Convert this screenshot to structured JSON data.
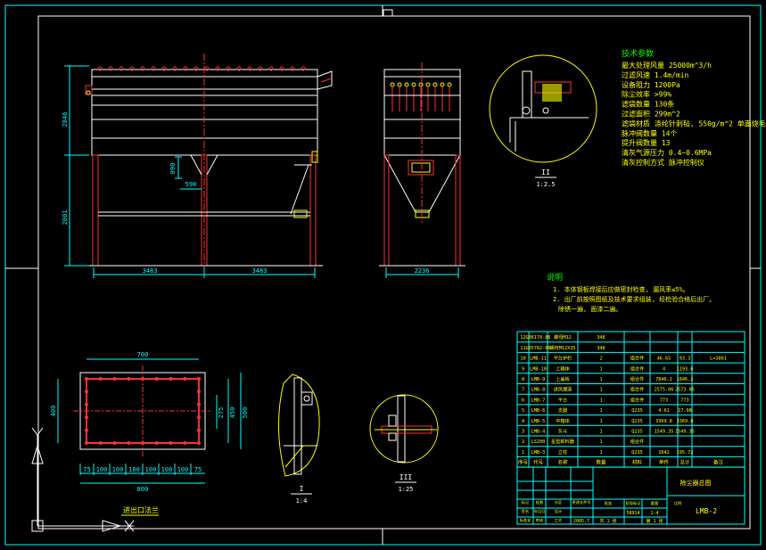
{
  "title_block": {
    "drawing_name": "除尘器总图",
    "drawing_no": "LMB-2",
    "labels": [
      "标记",
      "处数",
      "分区",
      "更改文件号",
      "签名",
      "年月日",
      "设计",
      "标准化",
      "审核",
      "工艺",
      "批准",
      "阶段标记",
      "重量",
      "比例"
    ],
    "weight": "58914",
    "scale": "1:4",
    "sheet": "共 1 张",
    "sheet_no": "第 1 张",
    "date": "2005.7"
  },
  "tech_params": {
    "heading": "技术参数",
    "lines": [
      "最大处理风量 25000m^3/h",
      "过滤风速 1.4m/min",
      "设备阻力 1200Pa",
      "除尘效率 >99%",
      "滤袋数量 130条",
      "过滤面积 299m^2",
      "滤袋材质 涤纶针刺毡, 550g/m^2 单面烧毛",
      "脉冲阀数量 14个",
      "提升阀数量 13",
      "清灰气源压力 0.4~0.6MPa",
      "清灰控制方式 脉冲控制仪"
    ]
  },
  "notes": {
    "heading": "说明",
    "lines": [
      "1. 本体钢板焊接后应做密封检查, 漏风率≤5%。",
      "2. 出厂前按照图纸及技术要求组装, 经检验合格后出厂。",
      "除锈一遍, 面漆二遍。"
    ]
  },
  "views": {
    "detail_2": {
      "label": "II",
      "scale": "1:2.5"
    },
    "detail_1": {
      "label": "I",
      "scale": "1:4"
    },
    "detail_3": {
      "label": "III",
      "scale": "1:25"
    },
    "flange_caption": "进出口法兰"
  },
  "dimensions": {
    "front_height_top": "2846",
    "front_height_bottom": "2001",
    "front_width_left": "3483",
    "front_width_right": "3483",
    "side_width": "2236",
    "hopper_outlet_h": "890",
    "hopper_outlet_w": "590",
    "flange_width": "700",
    "flange_overall": "800",
    "flange_height_left": "400",
    "flange_inner_h": "275",
    "flange_mid_h": "450",
    "flange_outer_h": "500",
    "flange_pitches": [
      "75",
      "100",
      "100",
      "100",
      "100",
      "100",
      "100",
      "75"
    ]
  },
  "bom": {
    "headers": [
      "序号",
      "代号",
      "名称",
      "数量",
      "材料",
      "单件",
      "总计",
      "备注"
    ],
    "rows": [
      [
        "12",
        "GB6170-86",
        "螺母M12",
        "348",
        "",
        "",
        "",
        ""
      ],
      [
        "11",
        "GB5782-86",
        "螺栓M12X35",
        "348",
        "",
        "",
        "",
        ""
      ],
      [
        "10",
        "LMB-11",
        "平台护栏",
        "2",
        "组合件",
        "46.65",
        "93.3",
        "L=3861"
      ],
      [
        "9",
        "LMB-10",
        "上箱体",
        "1",
        "组合件",
        "4",
        "1193.6",
        ""
      ],
      [
        "8",
        "LMB-9",
        "上盖板",
        "1",
        "组合件",
        "7846.2",
        "1846.2",
        ""
      ],
      [
        "7",
        "LMB-8",
        "进风烟道",
        "1",
        "组合件",
        "2575.06",
        "2573.05",
        ""
      ],
      [
        "6",
        "LMB-7",
        "平台",
        "1",
        "组合件",
        "773",
        "773",
        ""
      ],
      [
        "5",
        "LMB-6",
        "支腿",
        "1",
        "Q235",
        "4.61",
        "17.98",
        ""
      ],
      [
        "4",
        "LMB-5",
        "中箱体",
        "1",
        "Q235",
        "3369.8",
        "3369.8",
        ""
      ],
      [
        "3",
        "LMB-4",
        "灰斗",
        "1",
        "Q235",
        "1549.35",
        "1549.35",
        ""
      ],
      [
        "2",
        "LS200",
        "星型卸料器",
        "1",
        "组合件",
        "",
        ""
      ],
      [
        "1",
        "LMB-3",
        "立柱",
        "1",
        "Q235",
        "1642",
        "195.72",
        ""
      ]
    ]
  }
}
